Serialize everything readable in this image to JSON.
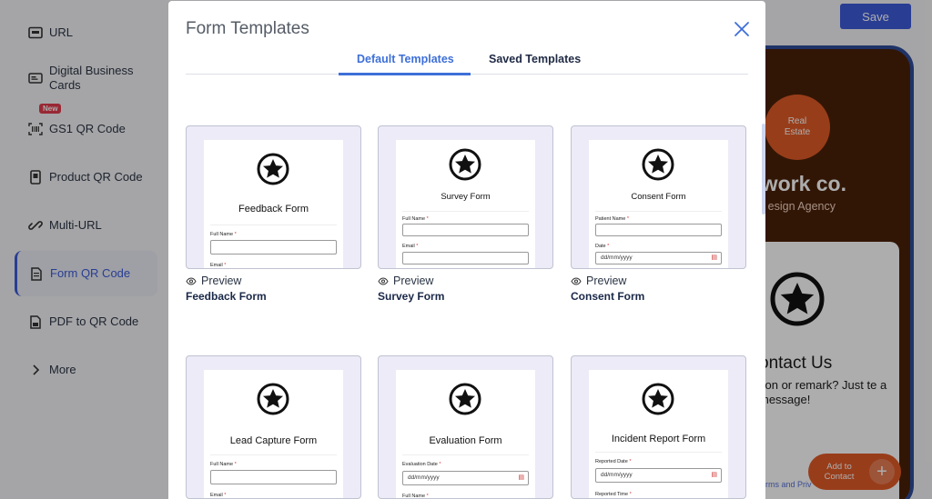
{
  "sidebar": {
    "items": [
      {
        "label": "URL",
        "icon": "url-icon"
      },
      {
        "label": "Digital Business Cards",
        "icon": "business-card-icon"
      },
      {
        "label": "GS1 QR Code",
        "icon": "barcode-icon",
        "badge": "New"
      },
      {
        "label": "Product QR Code",
        "icon": "product-icon"
      },
      {
        "label": "Multi-URL",
        "icon": "link-icon"
      },
      {
        "label": "Form QR Code",
        "icon": "form-icon",
        "active": true
      },
      {
        "label": "PDF to QR Code",
        "icon": "pdf-icon"
      },
      {
        "label": "More",
        "icon": "chevron-right-icon"
      }
    ]
  },
  "header": {
    "save_label": "Save"
  },
  "phone_preview": {
    "logo_text": "Real Estate",
    "company": "mwork co.",
    "tagline": "esign Agency",
    "contact_title": "ontact Us",
    "contact_text": "tion or remark? Just te a message!",
    "add_contact": "Add to Contact",
    "terms": "erms and Priv"
  },
  "modal": {
    "title": "Form Templates",
    "tabs": [
      {
        "label": "Default Templates",
        "active": true
      },
      {
        "label": "Saved Templates",
        "active": false
      }
    ],
    "preview_label": "Preview",
    "templates": [
      {
        "name": "Feedback Form",
        "form_title": "Feedback Form",
        "field1": "Full Name",
        "field1_value": "",
        "field2": "Email"
      },
      {
        "name": "Survey Form",
        "form_title": "Survey Form",
        "field1": "Full Name",
        "field1_value": "",
        "field2": "Email"
      },
      {
        "name": "Consent Form",
        "form_title": "Consent Form",
        "field1": "Patient Name",
        "field1_value": "",
        "field2": "Date",
        "field2_value": "dd/mm/yyyy"
      },
      {
        "name": "Lead Capture Form",
        "form_title": "Lead Capture Form",
        "field1": "Full Name",
        "field1_value": "",
        "field2": "Email"
      },
      {
        "name": "Evaluation Form",
        "form_title": "Evaluation Form",
        "field1": "Evaluation Date",
        "field1_value": "dd/mm/yyyy",
        "field2": "Full Name"
      },
      {
        "name": "Incident Report Form",
        "form_title": "Incident Report Form",
        "field1": "Reported Date",
        "field1_value": "dd/mm/yyyy",
        "field2": "Reported Time"
      }
    ]
  },
  "colors": {
    "accent": "#3d5bd9",
    "tab_active": "#3d6fd8",
    "brand_orange": "#e05a27",
    "phone_bg": "#4a2108"
  }
}
